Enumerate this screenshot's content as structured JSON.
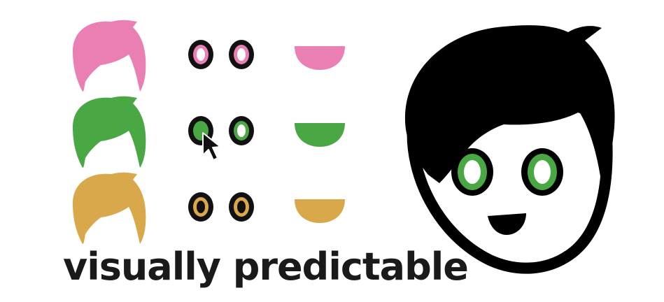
{
  "caption": "visually predictable",
  "options": [
    {
      "hair": "#e97fb3",
      "eye": "#e97fb3",
      "mouth": "#e97fb3"
    },
    {
      "hair": "#4aa844",
      "eye": "#4aa844",
      "mouth": "#4aa844",
      "selected": true
    },
    {
      "hair": "#d8a84a",
      "eye": "#d8a84a",
      "mouth": "#d8a84a"
    }
  ],
  "preview": {
    "hair": "#000000",
    "eye": "#4aa844",
    "skin": "#ffffff",
    "outline": "#000000",
    "mouth": "#000000"
  },
  "icons": {
    "cursor": "cursor-arrow-icon"
  }
}
